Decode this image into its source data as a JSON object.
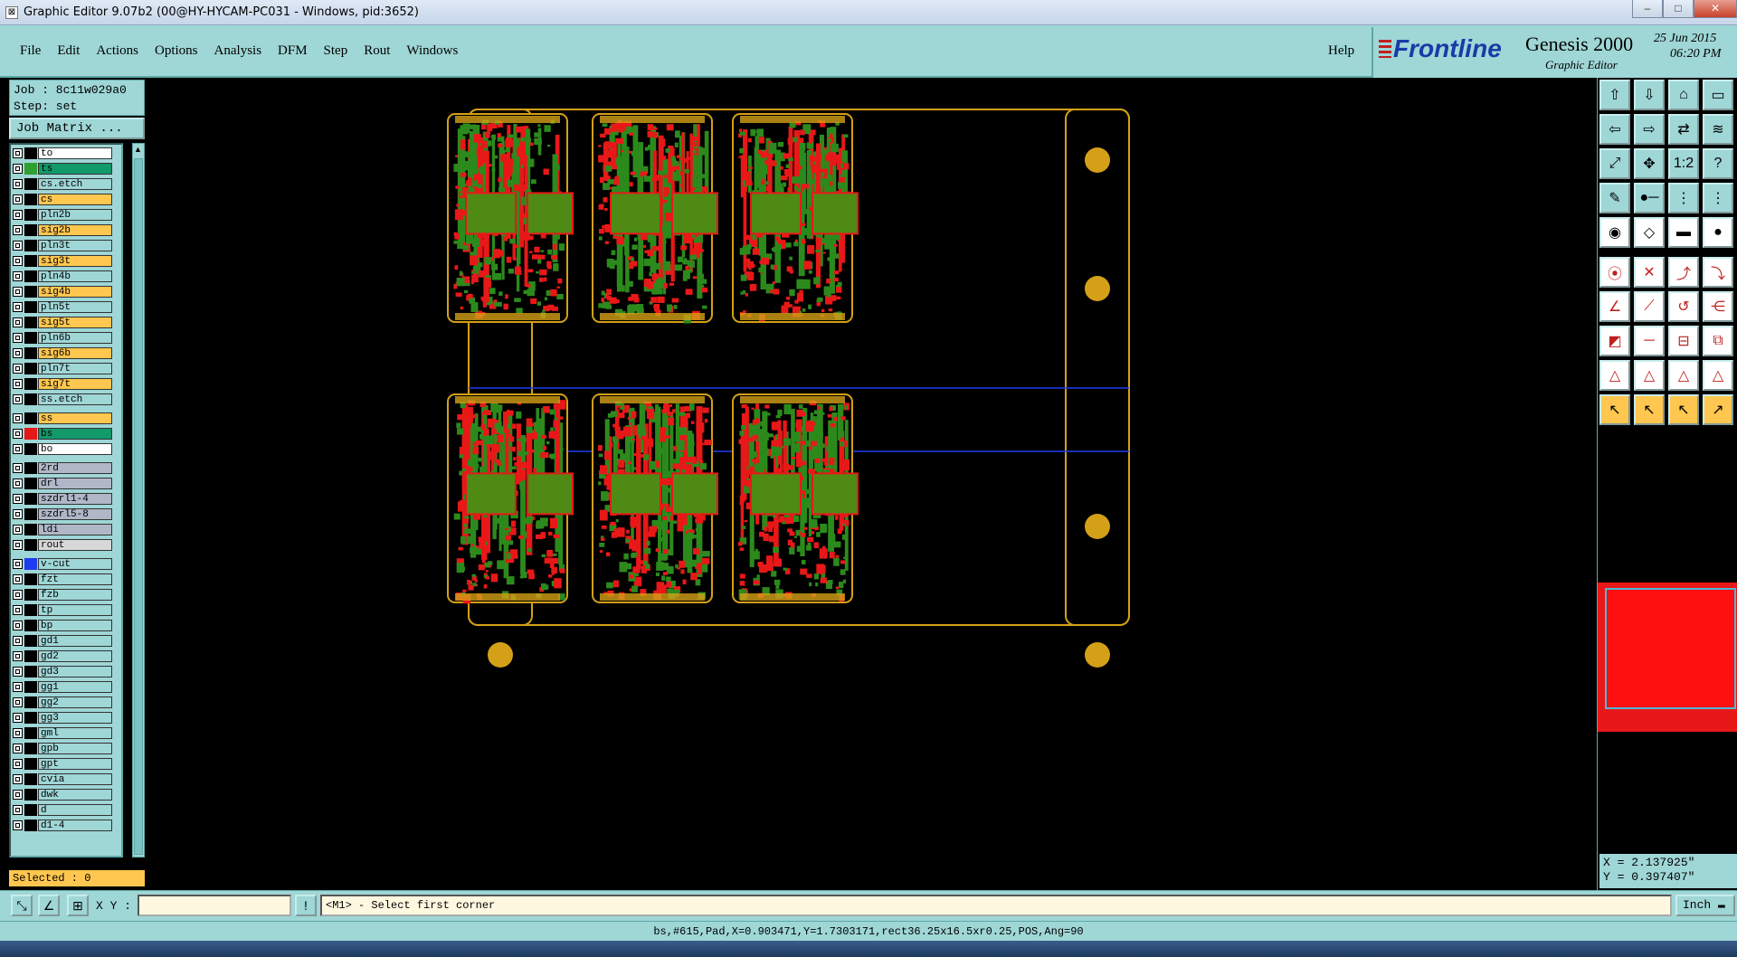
{
  "window": {
    "title": "Graphic Editor 9.07b2 (00@HY-HYCAM-PC031 - Windows, pid:3652)"
  },
  "menu": {
    "items": [
      "File",
      "Edit",
      "Actions",
      "Options",
      "Analysis",
      "DFM",
      "Step",
      "Rout",
      "Windows"
    ],
    "help": "Help"
  },
  "brand": {
    "logo": "Frontline",
    "product": "Genesis 2000",
    "subtitle": "Graphic Editor",
    "date": "25 Jun 2015",
    "time": "06:20 PM"
  },
  "job": {
    "job_label": "Job : 8c11w029a0",
    "step_label": "Step: set",
    "matrix_button": "Job Matrix ..."
  },
  "layers": [
    {
      "name": "to",
      "color": "#ffffff",
      "swatch": "#000000"
    },
    {
      "name": "ts",
      "color": "#139a6a",
      "swatch": "#2fa02f"
    },
    {
      "name": "cs.etch",
      "color": "#9fd6d6",
      "swatch": "#000000"
    },
    {
      "name": "cs",
      "color": "#ffc74f",
      "swatch": "#000000"
    },
    {
      "name": "pln2b",
      "color": "#9fd6d6",
      "swatch": "#000000"
    },
    {
      "name": "sig2b",
      "color": "#ffc74f",
      "swatch": "#000000"
    },
    {
      "name": "pln3t",
      "color": "#9fd6d6",
      "swatch": "#000000"
    },
    {
      "name": "sig3t",
      "color": "#ffc74f",
      "swatch": "#000000"
    },
    {
      "name": "pln4b",
      "color": "#9fd6d6",
      "swatch": "#000000"
    },
    {
      "name": "sig4b",
      "color": "#ffc74f",
      "swatch": "#000000"
    },
    {
      "name": "pln5t",
      "color": "#9fd6d6",
      "swatch": "#000000"
    },
    {
      "name": "sig5t",
      "color": "#ffc74f",
      "swatch": "#000000"
    },
    {
      "name": "pln6b",
      "color": "#9fd6d6",
      "swatch": "#000000"
    },
    {
      "name": "sig6b",
      "color": "#ffc74f",
      "swatch": "#000000"
    },
    {
      "name": "pln7t",
      "color": "#9fd6d6",
      "swatch": "#000000"
    },
    {
      "name": "sig7t",
      "color": "#ffc74f",
      "swatch": "#000000"
    },
    {
      "name": "ss.etch",
      "color": "#9fd6d6",
      "swatch": "#000000"
    },
    {
      "name": "ss",
      "color": "#ffc74f",
      "swatch": "#000000"
    },
    {
      "name": "bs",
      "color": "#139a6a",
      "swatch": "#e81818"
    },
    {
      "name": "bo",
      "color": "#ffffff",
      "swatch": "#000000"
    },
    {
      "name": "2rd",
      "color": "#b0b8c8",
      "swatch": "#000000"
    },
    {
      "name": "drl",
      "color": "#b0b8c8",
      "swatch": "#000000"
    },
    {
      "name": "szdrl1-4",
      "color": "#b0b8c8",
      "swatch": "#000000"
    },
    {
      "name": "szdrl5-8",
      "color": "#b0b8c8",
      "swatch": "#000000"
    },
    {
      "name": "ldi",
      "color": "#b0b8c8",
      "swatch": "#000000"
    },
    {
      "name": "rout",
      "color": "#d8d8d8",
      "swatch": "#000000"
    },
    {
      "name": "v-cut",
      "color": "#9fd6d6",
      "swatch": "#1e3cf0"
    },
    {
      "name": "fzt",
      "color": "#9fd6d6",
      "swatch": "#000000"
    },
    {
      "name": "fzb",
      "color": "#9fd6d6",
      "swatch": "#000000"
    },
    {
      "name": "tp",
      "color": "#9fd6d6",
      "swatch": "#000000"
    },
    {
      "name": "bp",
      "color": "#9fd6d6",
      "swatch": "#000000"
    },
    {
      "name": "gd1",
      "color": "#9fd6d6",
      "swatch": "#000000"
    },
    {
      "name": "gd2",
      "color": "#9fd6d6",
      "swatch": "#000000"
    },
    {
      "name": "gd3",
      "color": "#9fd6d6",
      "swatch": "#000000"
    },
    {
      "name": "gg1",
      "color": "#9fd6d6",
      "swatch": "#000000"
    },
    {
      "name": "gg2",
      "color": "#9fd6d6",
      "swatch": "#000000"
    },
    {
      "name": "gg3",
      "color": "#9fd6d6",
      "swatch": "#000000"
    },
    {
      "name": "gml",
      "color": "#9fd6d6",
      "swatch": "#000000"
    },
    {
      "name": "gpb",
      "color": "#9fd6d6",
      "swatch": "#000000"
    },
    {
      "name": "gpt",
      "color": "#9fd6d6",
      "swatch": "#000000"
    },
    {
      "name": "cvia",
      "color": "#9fd6d6",
      "swatch": "#000000"
    },
    {
      "name": "dwk",
      "color": "#9fd6d6",
      "swatch": "#000000"
    },
    {
      "name": "d",
      "color": "#9fd6d6",
      "swatch": "#000000"
    },
    {
      "name": "d1-4",
      "color": "#9fd6d6",
      "swatch": "#000000"
    }
  ],
  "selected": "Selected : 0",
  "coords": {
    "x": "X = 2.137925\"",
    "y": "Y = 0.397407\""
  },
  "input": {
    "xy_label": "X Y :",
    "xy_value": "",
    "prompt": "<M1> - Select first corner",
    "unit": "Inch"
  },
  "status": "bs,#615,Pad,X=0.903471,Y=1.7303171,rect36.25x16.5xr0.25,POS,Ang=90",
  "colors": {
    "panel": "#9fd6d6",
    "board_outline": "#d4a017",
    "copper": "#e81818",
    "mask": "#2c8a1c",
    "vcut": "#1e3cf0"
  }
}
